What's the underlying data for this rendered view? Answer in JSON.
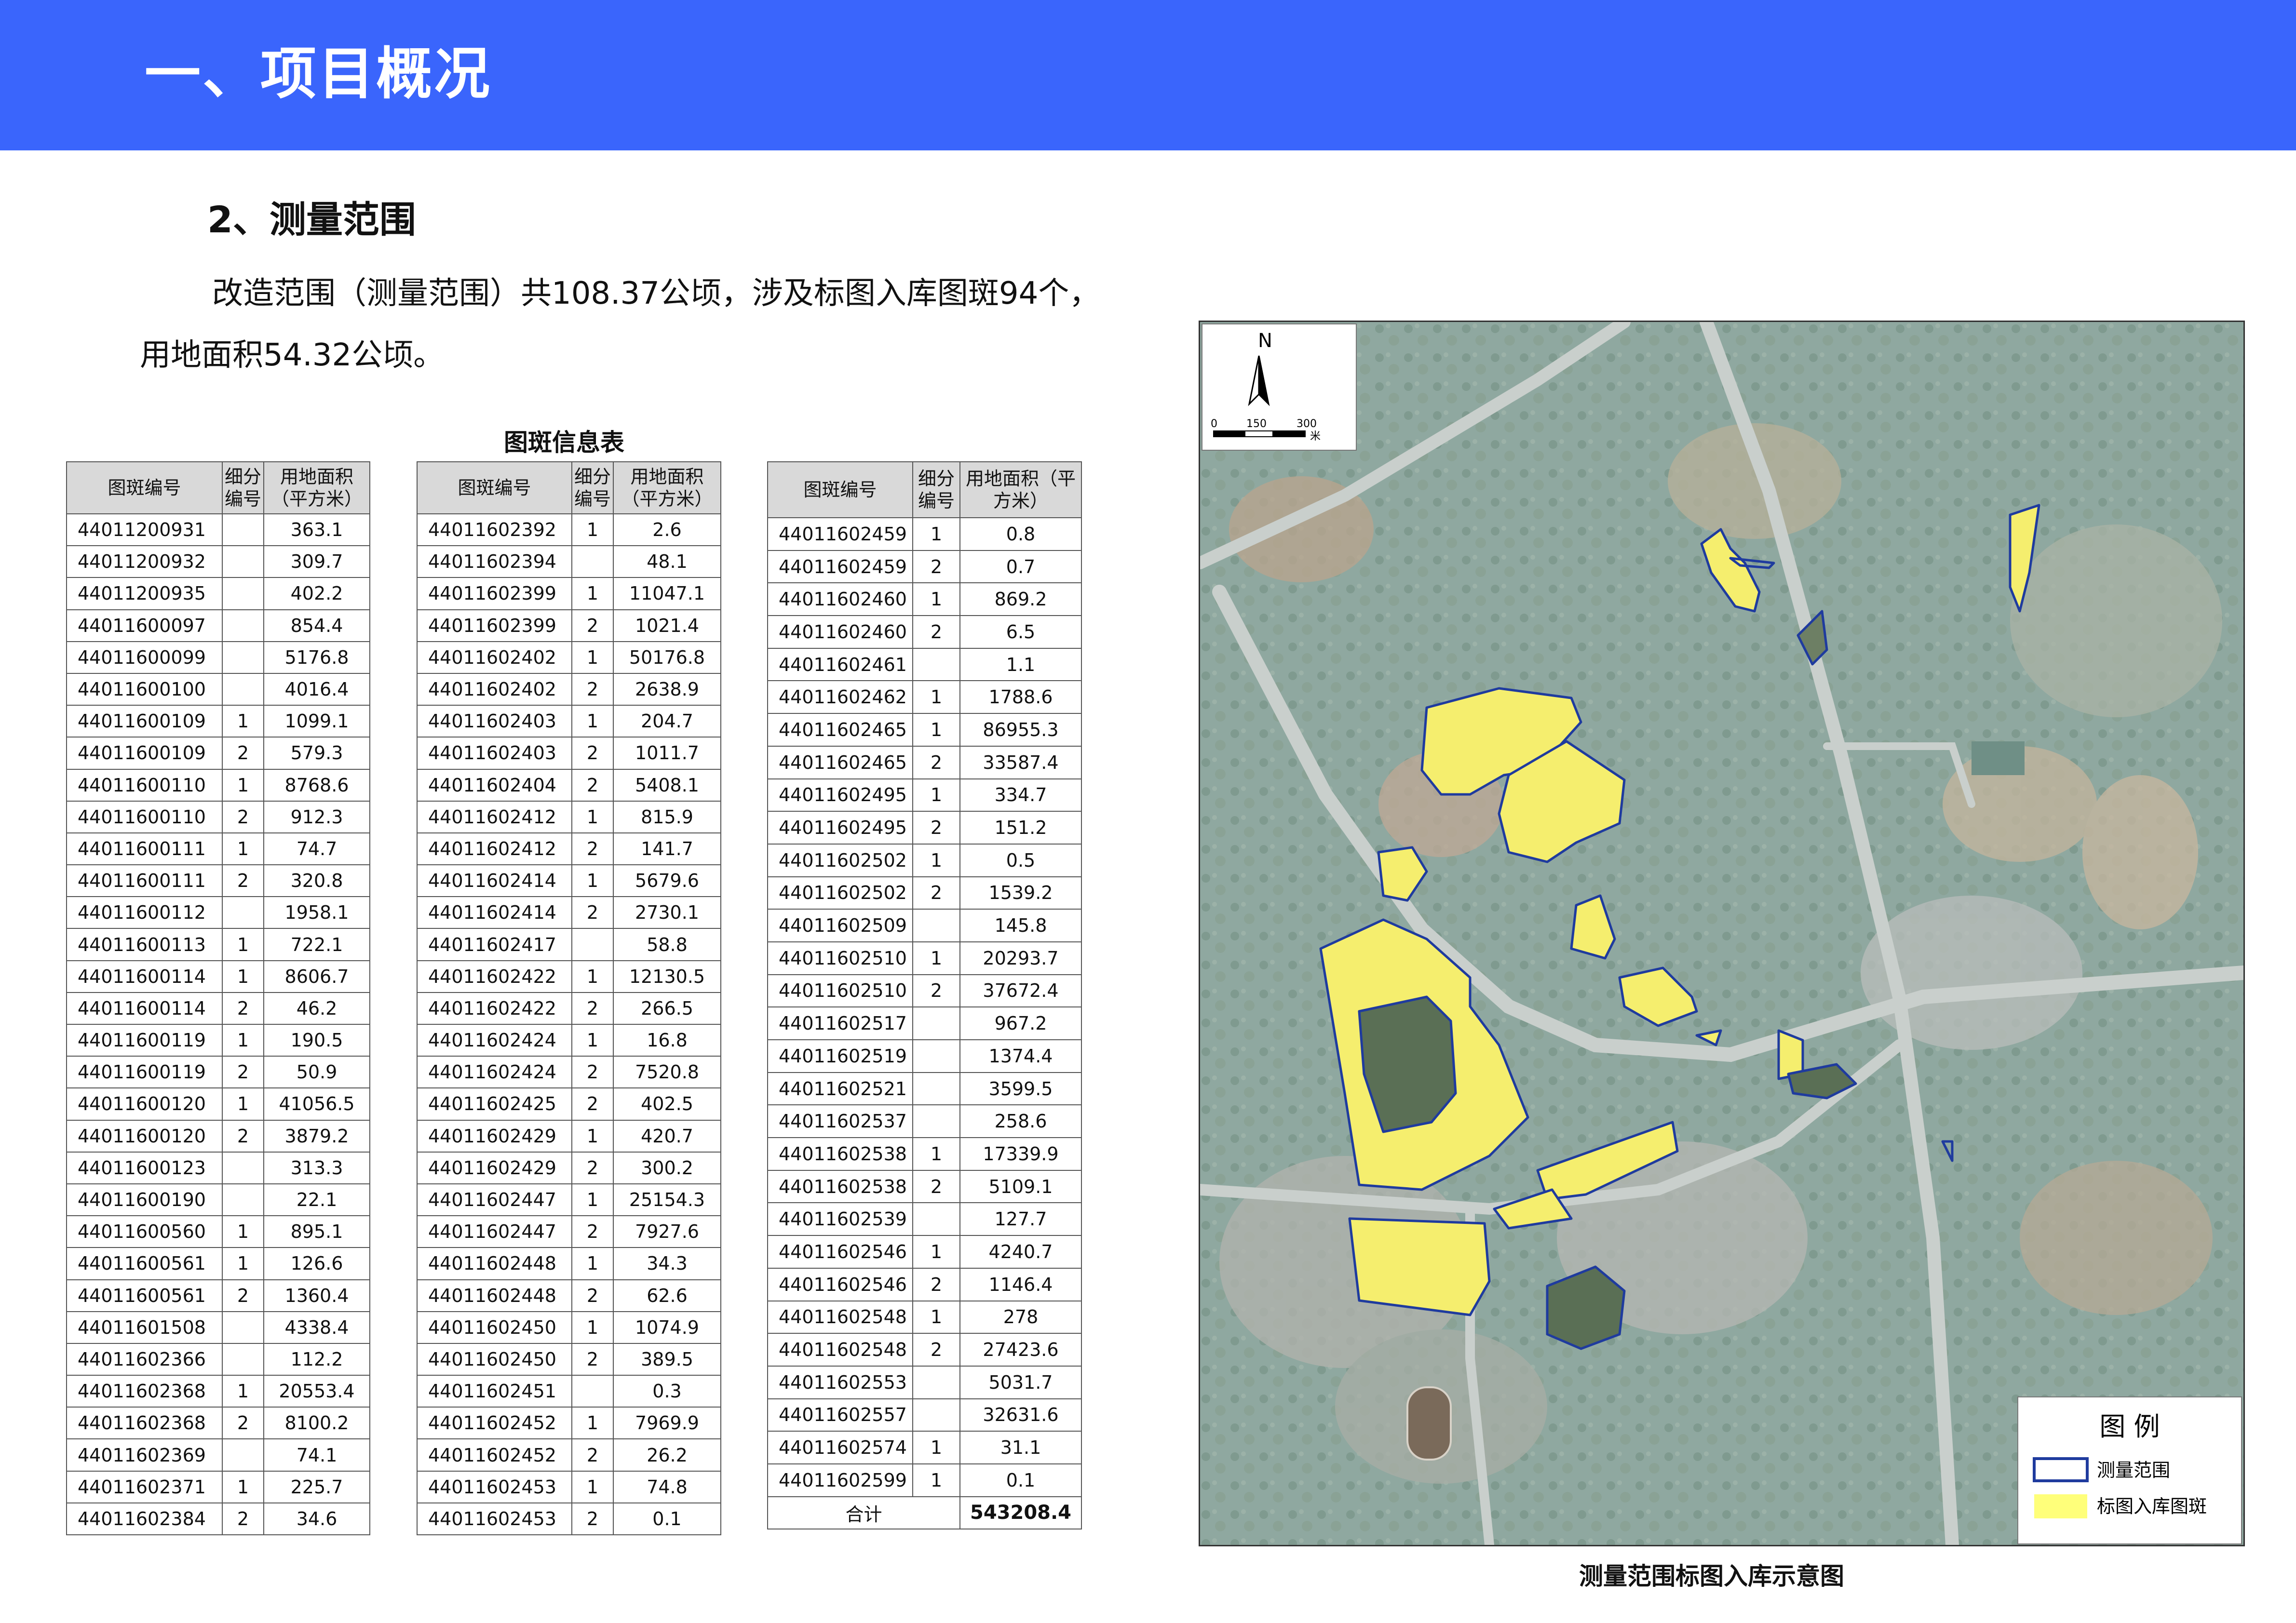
{
  "header": {
    "title": "一、项目概况"
  },
  "section": {
    "title": "2、测量范围"
  },
  "paragraph": {
    "text": "改造范围（测量范围）共108.37公顷，涉及标图入库图斑94个，用地面积54.32公顷。"
  },
  "table": {
    "caption": "图斑信息表",
    "headers": {
      "code": "图斑编号",
      "sub": "细分编号",
      "area": "用地面积（平方米）"
    },
    "columns": [
      [
        [
          "44011200931",
          "",
          "363.1"
        ],
        [
          "44011200932",
          "",
          "309.7"
        ],
        [
          "44011200935",
          "",
          "402.2"
        ],
        [
          "44011600097",
          "",
          "854.4"
        ],
        [
          "44011600099",
          "",
          "5176.8"
        ],
        [
          "44011600100",
          "",
          "4016.4"
        ],
        [
          "44011600109",
          "1",
          "1099.1"
        ],
        [
          "44011600109",
          "2",
          "579.3"
        ],
        [
          "44011600110",
          "1",
          "8768.6"
        ],
        [
          "44011600110",
          "2",
          "912.3"
        ],
        [
          "44011600111",
          "1",
          "74.7"
        ],
        [
          "44011600111",
          "2",
          "320.8"
        ],
        [
          "44011600112",
          "",
          "1958.1"
        ],
        [
          "44011600113",
          "1",
          "722.1"
        ],
        [
          "44011600114",
          "1",
          "8606.7"
        ],
        [
          "44011600114",
          "2",
          "46.2"
        ],
        [
          "44011600119",
          "1",
          "190.5"
        ],
        [
          "44011600119",
          "2",
          "50.9"
        ],
        [
          "44011600120",
          "1",
          "41056.5"
        ],
        [
          "44011600120",
          "2",
          "3879.2"
        ],
        [
          "44011600123",
          "",
          "313.3"
        ],
        [
          "44011600190",
          "",
          "22.1"
        ],
        [
          "44011600560",
          "1",
          "895.1"
        ],
        [
          "44011600561",
          "1",
          "126.6"
        ],
        [
          "44011600561",
          "2",
          "1360.4"
        ],
        [
          "44011601508",
          "",
          "4338.4"
        ],
        [
          "44011602366",
          "",
          "112.2"
        ],
        [
          "44011602368",
          "1",
          "20553.4"
        ],
        [
          "44011602368",
          "2",
          "8100.2"
        ],
        [
          "44011602369",
          "",
          "74.1"
        ],
        [
          "44011602371",
          "1",
          "225.7"
        ],
        [
          "44011602384",
          "2",
          "34.6"
        ]
      ],
      [
        [
          "44011602392",
          "1",
          "2.6"
        ],
        [
          "44011602394",
          "",
          "48.1"
        ],
        [
          "44011602399",
          "1",
          "11047.1"
        ],
        [
          "44011602399",
          "2",
          "1021.4"
        ],
        [
          "44011602402",
          "1",
          "50176.8"
        ],
        [
          "44011602402",
          "2",
          "2638.9"
        ],
        [
          "44011602403",
          "1",
          "204.7"
        ],
        [
          "44011602403",
          "2",
          "1011.7"
        ],
        [
          "44011602404",
          "2",
          "5408.1"
        ],
        [
          "44011602412",
          "1",
          "815.9"
        ],
        [
          "44011602412",
          "2",
          "141.7"
        ],
        [
          "44011602414",
          "1",
          "5679.6"
        ],
        [
          "44011602414",
          "2",
          "2730.1"
        ],
        [
          "44011602417",
          "",
          "58.8"
        ],
        [
          "44011602422",
          "1",
          "12130.5"
        ],
        [
          "44011602422",
          "2",
          "266.5"
        ],
        [
          "44011602424",
          "1",
          "16.8"
        ],
        [
          "44011602424",
          "2",
          "7520.8"
        ],
        [
          "44011602425",
          "2",
          "402.5"
        ],
        [
          "44011602429",
          "1",
          "420.7"
        ],
        [
          "44011602429",
          "2",
          "300.2"
        ],
        [
          "44011602447",
          "1",
          "25154.3"
        ],
        [
          "44011602447",
          "2",
          "7927.6"
        ],
        [
          "44011602448",
          "1",
          "34.3"
        ],
        [
          "44011602448",
          "2",
          "62.6"
        ],
        [
          "44011602450",
          "1",
          "1074.9"
        ],
        [
          "44011602450",
          "2",
          "389.5"
        ],
        [
          "44011602451",
          "",
          "0.3"
        ],
        [
          "44011602452",
          "1",
          "7969.9"
        ],
        [
          "44011602452",
          "2",
          "26.2"
        ],
        [
          "44011602453",
          "1",
          "74.8"
        ],
        [
          "44011602453",
          "2",
          "0.1"
        ]
      ],
      [
        [
          "44011602459",
          "1",
          "0.8"
        ],
        [
          "44011602459",
          "2",
          "0.7"
        ],
        [
          "44011602460",
          "1",
          "869.2"
        ],
        [
          "44011602460",
          "2",
          "6.5"
        ],
        [
          "44011602461",
          "",
          "1.1"
        ],
        [
          "44011602462",
          "1",
          "1788.6"
        ],
        [
          "44011602465",
          "1",
          "86955.3"
        ],
        [
          "44011602465",
          "2",
          "33587.4"
        ],
        [
          "44011602495",
          "1",
          "334.7"
        ],
        [
          "44011602495",
          "2",
          "151.2"
        ],
        [
          "44011602502",
          "1",
          "0.5"
        ],
        [
          "44011602502",
          "2",
          "1539.2"
        ],
        [
          "44011602509",
          "",
          "145.8"
        ],
        [
          "44011602510",
          "1",
          "20293.7"
        ],
        [
          "44011602510",
          "2",
          "37672.4"
        ],
        [
          "44011602517",
          "",
          "967.2"
        ],
        [
          "44011602519",
          "",
          "1374.4"
        ],
        [
          "44011602521",
          "",
          "3599.5"
        ],
        [
          "44011602537",
          "",
          "258.6"
        ],
        [
          "44011602538",
          "1",
          "17339.9"
        ],
        [
          "44011602538",
          "2",
          "5109.1"
        ],
        [
          "44011602539",
          "",
          "127.7"
        ],
        [
          "44011602546",
          "1",
          "4240.7"
        ],
        [
          "44011602546",
          "2",
          "1146.4"
        ],
        [
          "44011602548",
          "1",
          "278"
        ],
        [
          "44011602548",
          "2",
          "27423.6"
        ],
        [
          "44011602553",
          "",
          "5031.7"
        ],
        [
          "44011602557",
          "",
          "32631.6"
        ],
        [
          "44011602574",
          "1",
          "31.1"
        ],
        [
          "44011602599",
          "1",
          "0.1"
        ]
      ]
    ],
    "total_label": "合计",
    "total_value": "543208.4"
  },
  "map": {
    "caption": "测量范围标图入库示意图",
    "north": "N",
    "scale": {
      "ticks": [
        "0",
        "150",
        "300"
      ],
      "unit": "米"
    },
    "legend": {
      "title": "图  例",
      "items": [
        {
          "label": "测量范围",
          "symbol": "blue-outline",
          "color": "#1f3b9e"
        },
        {
          "label": "标图入库图斑",
          "symbol": "yellow-fill",
          "color": "#ffff7a"
        }
      ]
    }
  },
  "colors": {
    "header_bg": "#3a65fc",
    "table_header_bg": "#d9d9d9",
    "boundary": "#1f3b9e",
    "parcel": "#ffff7a"
  }
}
